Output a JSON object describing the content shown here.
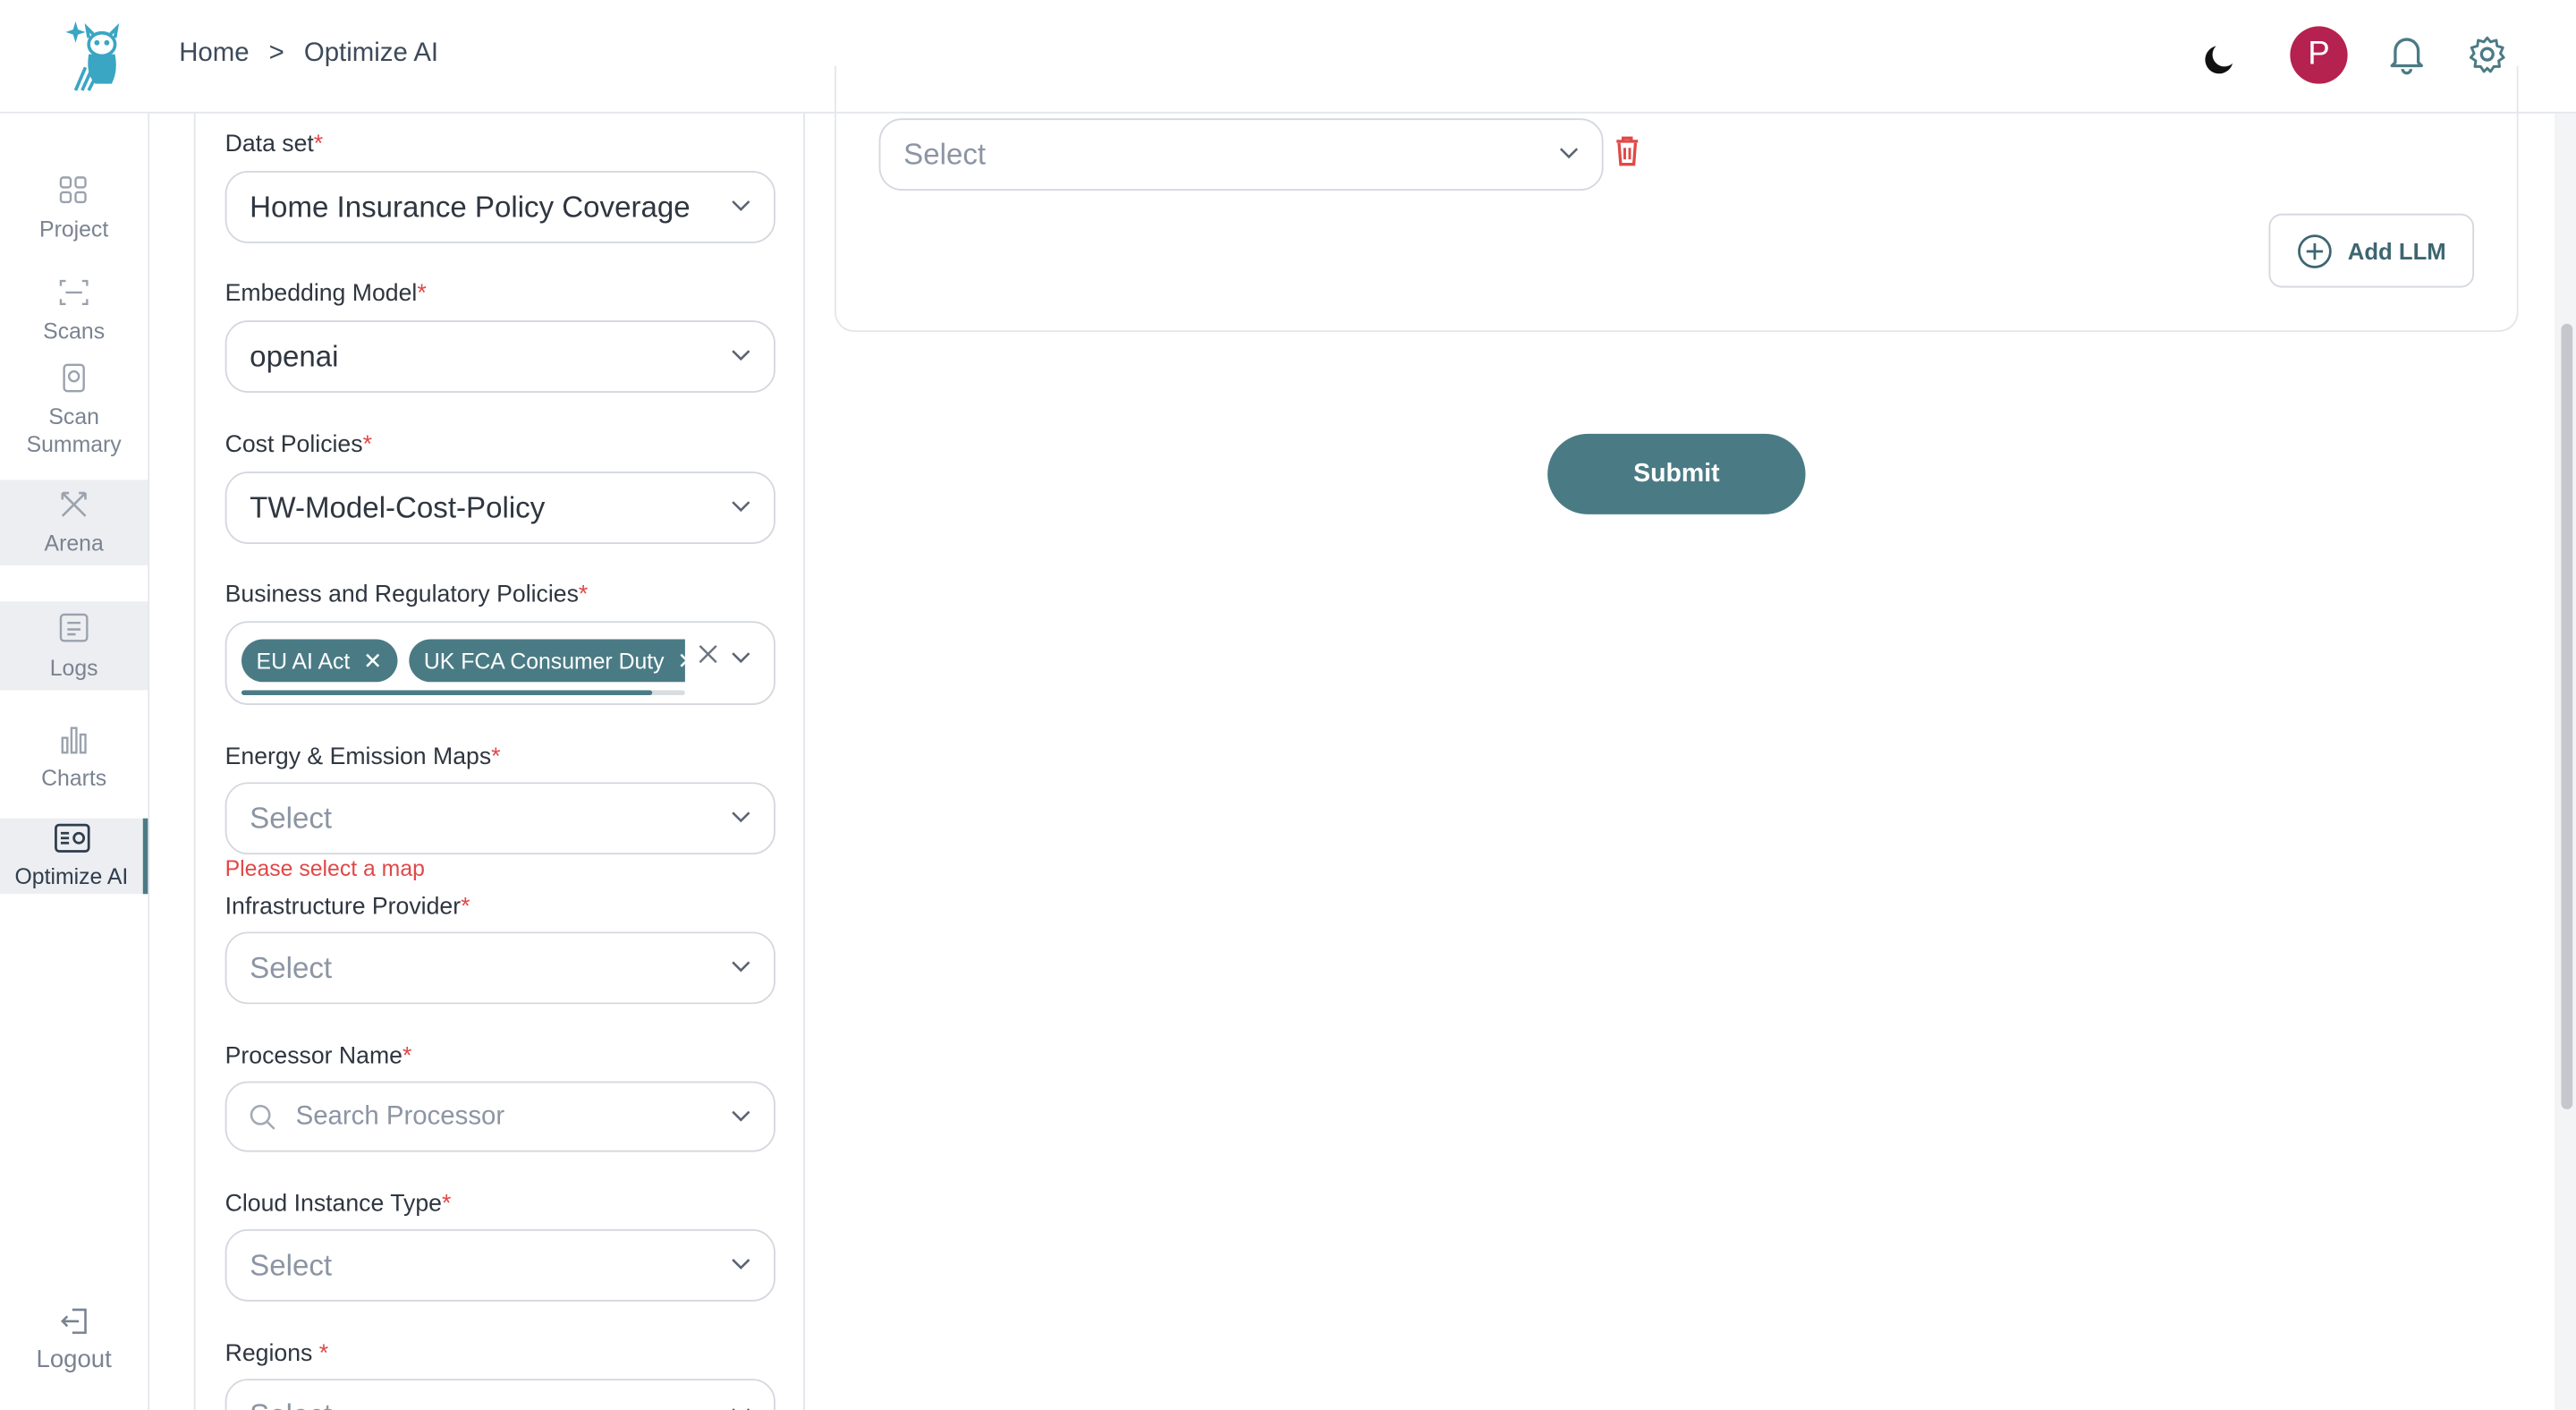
{
  "header": {
    "breadcrumb_home": "Home",
    "breadcrumb_sep": ">",
    "breadcrumb_current": "Optimize AI",
    "avatar_initial": "P",
    "accent_color": "#4a7b85",
    "avatar_color": "#b5224f"
  },
  "sidebar": {
    "items": [
      {
        "label": "Project",
        "icon": "grid-icon"
      },
      {
        "label": "Scans",
        "icon": "scan-icon"
      },
      {
        "label": "Scan Summary",
        "icon": "scan-summary-icon"
      },
      {
        "label": "Arena",
        "icon": "arena-icon"
      },
      {
        "label": "Logs",
        "icon": "logs-icon"
      },
      {
        "label": "Charts",
        "icon": "bar-chart-icon"
      },
      {
        "label": "Optimize AI",
        "icon": "optimize-icon"
      }
    ],
    "logout": "Logout"
  },
  "form": {
    "dataset": {
      "label": "Data set",
      "value": "Home Insurance Policy Coverage"
    },
    "embedding": {
      "label": "Embedding Model",
      "value": "openai"
    },
    "cost": {
      "label": "Cost Policies",
      "value": "TW-Model-Cost-Policy"
    },
    "business": {
      "label": "Business and Regulatory Policies",
      "chips": [
        "EU AI Act",
        "UK FCA Consumer Duty"
      ]
    },
    "energy": {
      "label": "Energy & Emission Maps",
      "placeholder": "Select",
      "error": "Please select a map"
    },
    "infra": {
      "label": "Infrastructure Provider",
      "placeholder": "Select"
    },
    "processor": {
      "label": "Processor Name",
      "placeholder": "Search Processor"
    },
    "cloud": {
      "label": "Cloud Instance Type",
      "placeholder": "Select"
    },
    "regions": {
      "label": "Regions ",
      "placeholder": "Select"
    },
    "required_mark": "*"
  },
  "llm": {
    "placeholder": "Select",
    "add_label": "Add LLM"
  },
  "submit_label": "Submit"
}
